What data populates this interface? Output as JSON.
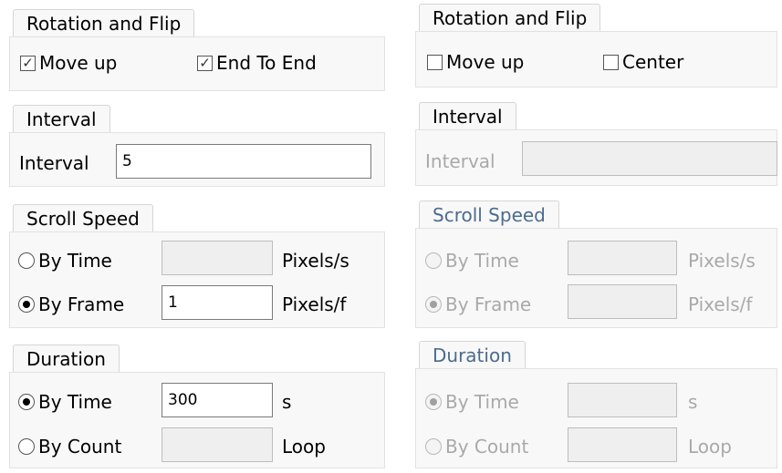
{
  "left": {
    "rotation": {
      "title": "Rotation and Flip",
      "move_up": {
        "label": "Move up",
        "checked": true
      },
      "end_to_end": {
        "label": "End To End",
        "checked": true
      }
    },
    "interval": {
      "title": "Interval",
      "label": "Interval",
      "value": "5"
    },
    "scroll_speed": {
      "title": "Scroll Speed",
      "by_time": {
        "label": "By Time",
        "value": "",
        "unit": "Pixels/s",
        "selected": false
      },
      "by_frame": {
        "label": "By Frame",
        "value": "1",
        "unit": "Pixels/f",
        "selected": true
      }
    },
    "duration": {
      "title": "Duration",
      "by_time": {
        "label": "By Time",
        "value": "300",
        "unit": "s",
        "selected": true
      },
      "by_count": {
        "label": "By Count",
        "value": "",
        "unit": "Loop",
        "selected": false
      }
    }
  },
  "right": {
    "rotation": {
      "title": "Rotation and Flip",
      "move_up": {
        "label": "Move up",
        "checked": false
      },
      "center": {
        "label": "Center",
        "checked": false
      }
    },
    "interval": {
      "title": "Interval",
      "label": "Interval",
      "value": ""
    },
    "scroll_speed": {
      "title": "Scroll Speed",
      "by_time": {
        "label": "By Time",
        "value": "",
        "unit": "Pixels/s",
        "selected": false
      },
      "by_frame": {
        "label": "By Frame",
        "value": "",
        "unit": "Pixels/f",
        "selected": true
      }
    },
    "duration": {
      "title": "Duration",
      "by_time": {
        "label": "By Time",
        "value": "",
        "unit": "s",
        "selected": true
      },
      "by_count": {
        "label": "By Count",
        "value": "",
        "unit": "Loop",
        "selected": false
      }
    }
  }
}
